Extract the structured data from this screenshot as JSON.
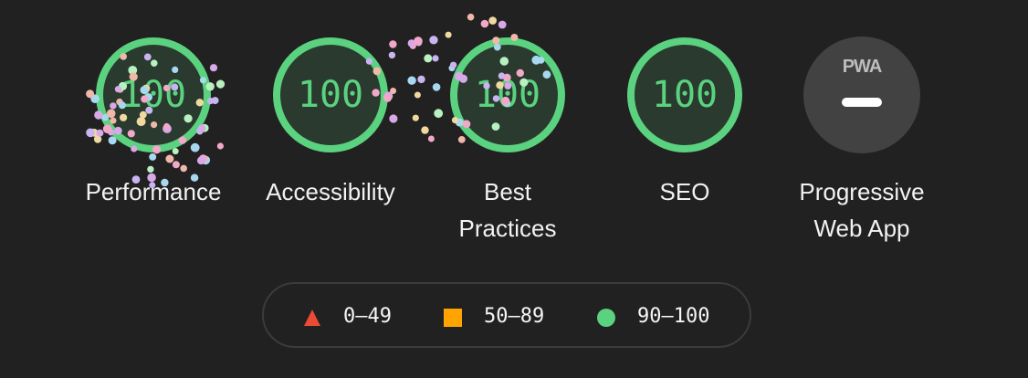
{
  "colors": {
    "background": "#212121",
    "pass": "#5bd27f",
    "pass_fill": "#2a3a2e",
    "average": "#ffa400",
    "fail": "#eb4a35",
    "pwa_badge": "#424242"
  },
  "categories": [
    {
      "label": "Performance",
      "score": "100",
      "value": 1.0
    },
    {
      "label": "Accessibility",
      "score": "100",
      "value": 1.0
    },
    {
      "label": "Best Practices",
      "score": "100",
      "value": 1.0
    },
    {
      "label": "SEO",
      "score": "100",
      "value": 1.0
    }
  ],
  "pwa": {
    "badge_text": "PWA",
    "label": "Progressive Web App"
  },
  "legend": {
    "fail": {
      "icon": "triangle-icon",
      "text": "0–49"
    },
    "average": {
      "icon": "square-icon",
      "text": "50–89"
    },
    "pass": {
      "icon": "circle-icon",
      "text": "90–100"
    }
  }
}
